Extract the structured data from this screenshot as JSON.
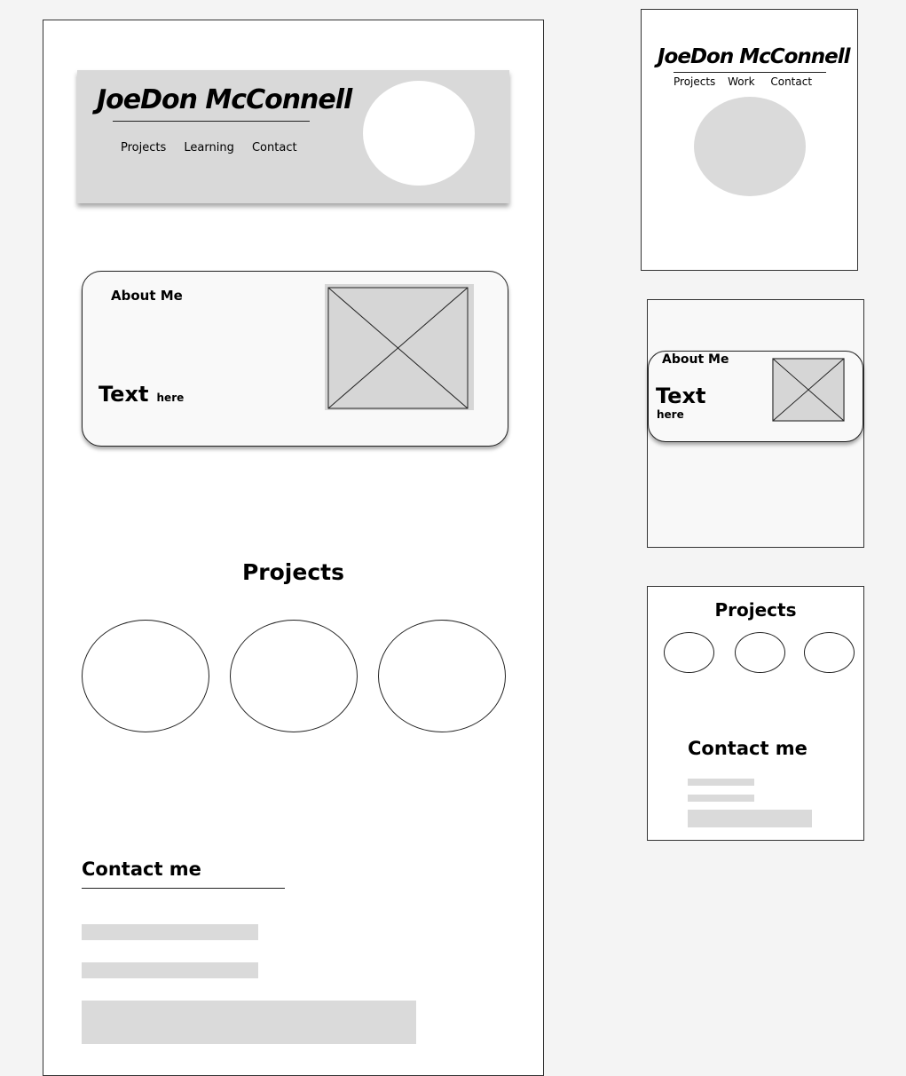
{
  "site": {
    "name": "JoeDon McConnell"
  },
  "desktop": {
    "nav": [
      "Projects",
      "Learning",
      "Contact"
    ],
    "about_title": "About Me",
    "about_text_big": "Text",
    "about_text_small": "here",
    "projects_title": "Projects",
    "contact_title": "Contact me"
  },
  "mobile": {
    "nav": [
      "Projects",
      "Work",
      "Contact"
    ],
    "about_title": "About Me",
    "about_text_big": "Text",
    "about_text_small": "here",
    "projects_title": "Projects",
    "contact_title": "Contact me"
  }
}
